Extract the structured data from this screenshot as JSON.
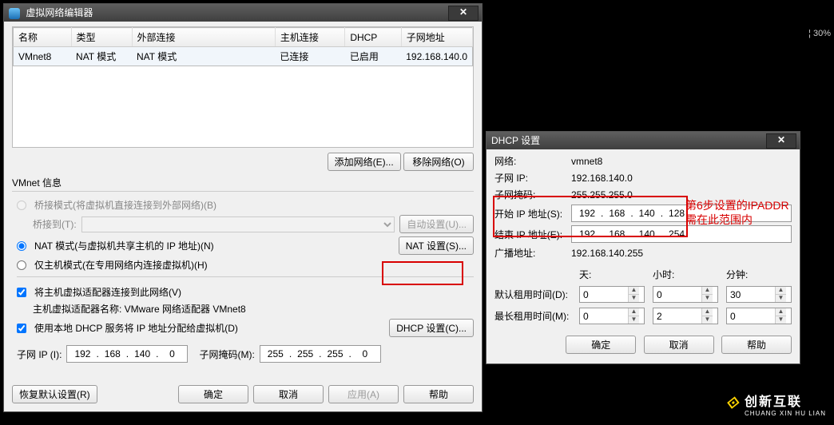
{
  "main": {
    "title": "虚拟网络编辑器",
    "columns": {
      "name": "名称",
      "type": "类型",
      "ext": "外部连接",
      "host": "主机连接",
      "dhcp": "DHCP",
      "subnet": "子网地址"
    },
    "row": {
      "name": "VMnet8",
      "type": "NAT 模式",
      "ext": "NAT 模式",
      "host": "已连接",
      "dhcp": "已启用",
      "subnet": "192.168.140.0"
    },
    "btn": {
      "add": "添加网络(E)...",
      "remove": "移除网络(O)"
    },
    "section": "VMnet 信息",
    "opt": {
      "bridge": "桥接模式(将虚拟机直接连接到外部网络)(B)",
      "bridgeto": "桥接到(T):",
      "autoset": "自动设置(U)...",
      "nat": "NAT 模式(与虚拟机共享主机的 IP 地址)(N)",
      "natset": "NAT 设置(S)...",
      "hostonly": "仅主机模式(在专用网络内连接虚拟机)(H)",
      "hostadapter": "将主机虚拟适配器连接到此网络(V)",
      "adaptername": "主机虚拟适配器名称: VMware 网络适配器 VMnet8",
      "usedhcp": "使用本地 DHCP 服务将 IP 地址分配给虚拟机(D)",
      "dhcpset": "DHCP 设置(C)..."
    },
    "subnetip": "子网 IP (I):",
    "subnetmask": "子网掩码(M):",
    "ip": {
      "a": "192",
      "b": "168",
      "c": "140",
      "d": "0"
    },
    "mask": {
      "a": "255",
      "b": "255",
      "c": "255",
      "d": "0"
    },
    "foot": {
      "restore": "恢复默认设置(R)",
      "ok": "确定",
      "cancel": "取消",
      "apply": "应用(A)",
      "help": "帮助"
    }
  },
  "dhcp": {
    "title": "DHCP 设置",
    "lbl": {
      "net": "网络:",
      "subnetip": "子网 IP:",
      "mask": "子网掩码:",
      "start": "开始 IP 地址(S):",
      "end": "结束 IP 地址(E):",
      "bcast": "广播地址:",
      "def": "默认租用时间(D):",
      "max": "最长租用时间(M):",
      "days": "天:",
      "hrs": "小时:",
      "min": "分钟:"
    },
    "val": {
      "net": "vmnet8",
      "subnetip": "192.168.140.0",
      "mask": "255.255.255.0",
      "bcast": "192.168.140.255"
    },
    "start": {
      "a": "192",
      "b": "168",
      "c": "140",
      "d": "128"
    },
    "end": {
      "a": "192",
      "b": "168",
      "c": "140",
      "d": "254"
    },
    "time": {
      "def_d": "0",
      "def_h": "0",
      "def_m": "30",
      "max_d": "0",
      "max_h": "2",
      "max_m": "0"
    },
    "btn": {
      "ok": "确定",
      "cancel": "取消",
      "help": "帮助"
    }
  },
  "annot": "第6步设置的IPADDR\n需在此范围内",
  "pct": "¦ 30%",
  "logo": {
    "cn": "创新互联",
    "en": "CHUANG XIN HU LIAN"
  }
}
